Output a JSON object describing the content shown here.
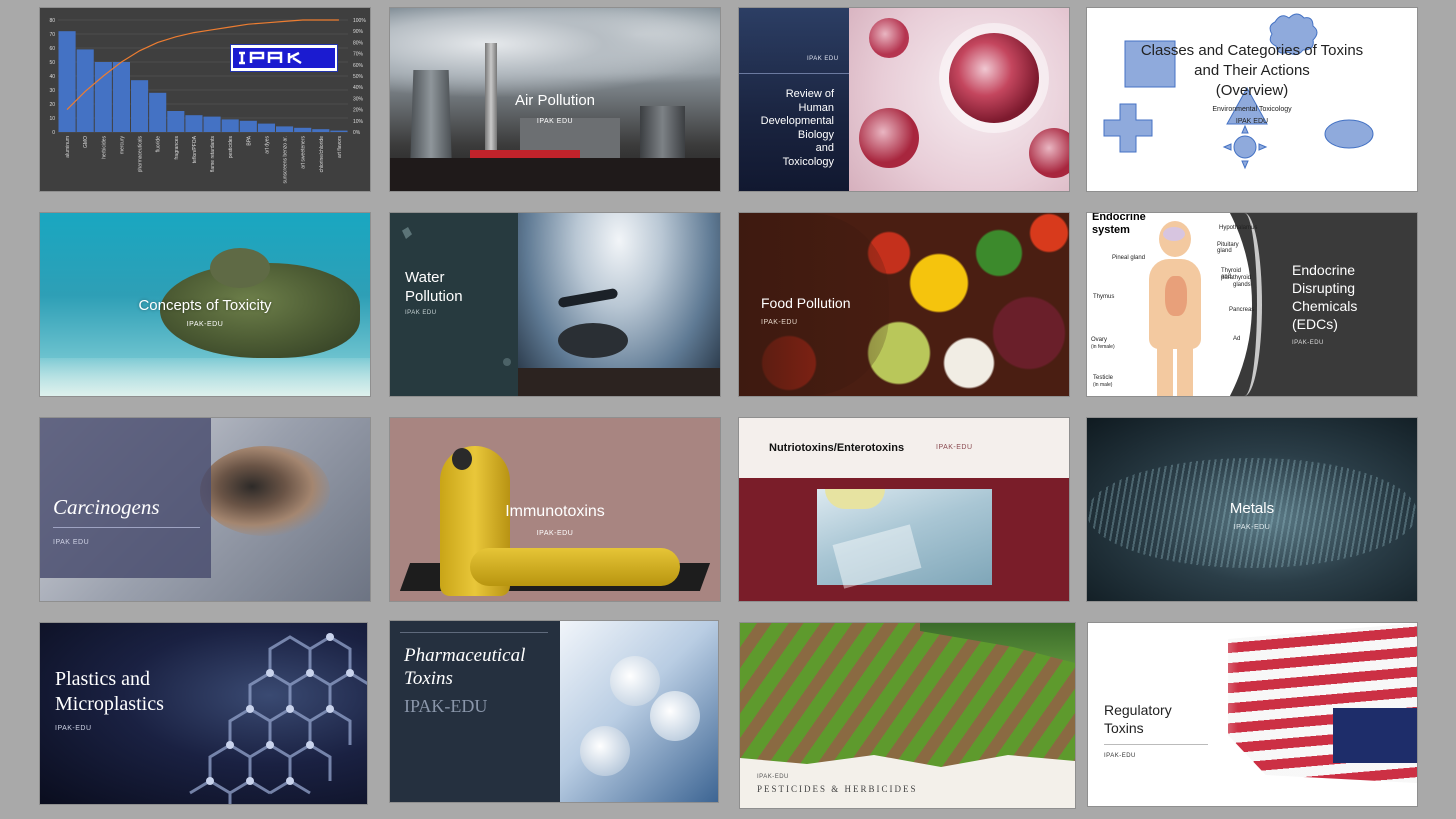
{
  "slides": [
    {
      "id": "chart",
      "logo": "IPAK"
    },
    {
      "id": "air",
      "title": "Air Pollution",
      "subtitle": "IPAK EDU"
    },
    {
      "id": "dev",
      "label": "IPAK EDU",
      "title_lines": [
        "Review of",
        "Human",
        "Developmental",
        "Biology",
        "and",
        "Toxicology"
      ]
    },
    {
      "id": "classes",
      "title_lines": [
        "Classes and Categories of Toxins",
        "and Their Actions",
        "(Overview)"
      ],
      "subtitle": "Environmental Toxicology",
      "label": "IPAK EDU"
    },
    {
      "id": "concepts",
      "title": "Concepts of Toxicity",
      "subtitle": "IPAK-EDU"
    },
    {
      "id": "water",
      "title_lines": [
        "Water",
        "Pollution"
      ],
      "subtitle": "IPAK EDU"
    },
    {
      "id": "food",
      "title": "Food Pollution",
      "subtitle": "IPAK-EDU"
    },
    {
      "id": "endocrine",
      "diagram_title_lines": [
        "Endocrine",
        "system"
      ],
      "labels_left": [
        "Pineal gland",
        "Thymus",
        "Ovary",
        "(in female)",
        "Testicle",
        "(in male)"
      ],
      "labels_right": [
        "Hypothalamus",
        "Pituitary gland",
        "Thyroid and",
        "parathyroid",
        "glands",
        "Pancreas",
        "Ad"
      ],
      "title_lines": [
        "Endocrine",
        "Disrupting",
        "Chemicals",
        "(EDCs)"
      ],
      "subtitle": "IPAK-EDU"
    },
    {
      "id": "carcinogens",
      "title": "Carcinogens",
      "subtitle": "IPAK EDU"
    },
    {
      "id": "immuno",
      "title": "Immunotoxins",
      "subtitle": "IPAK-EDU"
    },
    {
      "id": "nutrio",
      "title": "Nutriotoxins/Enterotoxins",
      "subtitle": "IPAK-EDU"
    },
    {
      "id": "metals",
      "title": "Metals",
      "subtitle": "IPAK-EDU"
    },
    {
      "id": "plastics",
      "title_lines": [
        "Plastics and",
        "Microplastics"
      ],
      "subtitle": "IPAK-EDU"
    },
    {
      "id": "pharma",
      "title_lines": [
        "Pharmaceutical",
        "Toxins"
      ],
      "subtitle": "IPAK-EDU"
    },
    {
      "id": "pesticides",
      "label": "IPAK-EDU",
      "title": "PESTICIDES & HERBICIDES"
    },
    {
      "id": "regulatory",
      "title_lines": [
        "Regulatory",
        "Toxins"
      ],
      "subtitle": "IPAK-EDU"
    }
  ],
  "chart_data": {
    "type": "bar",
    "categories": [
      "aluminum",
      "GMO",
      "herbicides",
      "mercury",
      "pharmaceuticals",
      "fluoride",
      "fragrances",
      "teflon/PFOA",
      "flame retardants",
      "pesticides",
      "BPA",
      "art dyes",
      "sunscreens benzo ar.",
      "art sweeteners",
      "chlorine/chloride",
      "art flavors"
    ],
    "values": [
      72,
      59,
      50,
      50,
      37,
      28,
      15,
      12,
      11,
      9,
      8,
      6,
      4,
      3,
      2,
      1
    ],
    "line_series": {
      "values": [
        16,
        29,
        40,
        50,
        58,
        64,
        68,
        71,
        73,
        75,
        77,
        78,
        79,
        80,
        80,
        80
      ]
    },
    "y_ticks_left": [
      "0",
      "10",
      "20",
      "30",
      "40",
      "50",
      "60",
      "70",
      "80"
    ],
    "y_ticks_right": [
      "0%",
      "10%",
      "20%",
      "30%",
      "40%",
      "50%",
      "60%",
      "70%",
      "80%",
      "90%",
      "100%"
    ],
    "ylim": [
      0,
      80
    ],
    "colors": {
      "bar": "#4472c4",
      "line": "#ed7d31"
    }
  }
}
